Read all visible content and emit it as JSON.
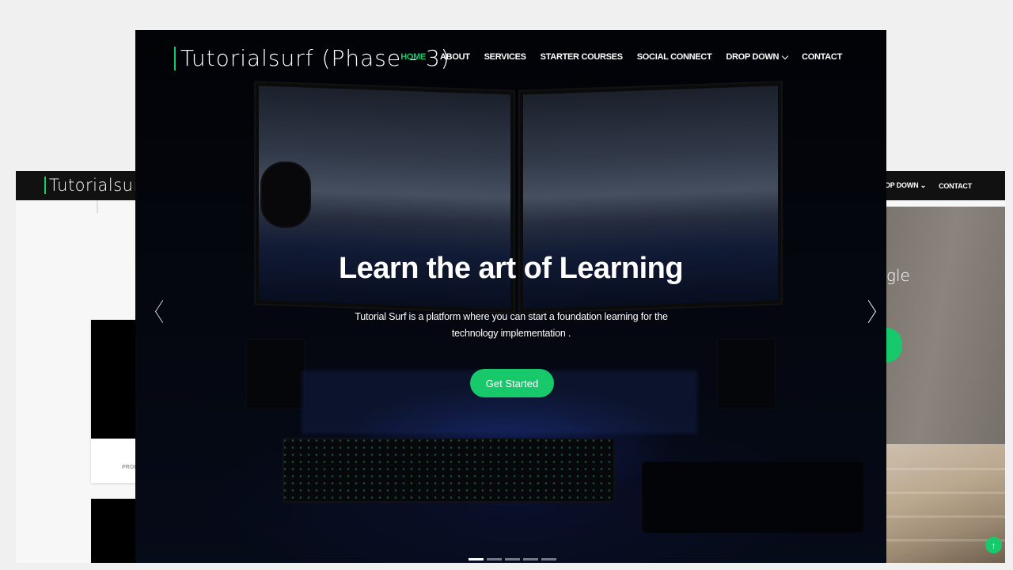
{
  "back_window": {
    "brand": "Tutorialsurf",
    "nav": [
      {
        "label": "DROP DOWN",
        "has_dropdown": true
      },
      {
        "label": "CONTACT"
      }
    ],
    "hero_text_fragment": "gle",
    "card_label_fragment": "PROC",
    "scroll_top_icon": "arrow-up-icon"
  },
  "front_window": {
    "brand": "Tutorialsurf (Phase - 3)",
    "nav": [
      {
        "label": "HOME",
        "active": true
      },
      {
        "label": "ABOUT"
      },
      {
        "label": "SERVICES"
      },
      {
        "label": "STARTER COURSES"
      },
      {
        "label": "SOCIAL CONNECT"
      },
      {
        "label": "DROP DOWN",
        "has_dropdown": true
      },
      {
        "label": "CONTACT"
      }
    ],
    "hero": {
      "title": "Learn the art of Learning",
      "subtitle": "Tutorial Surf is a platform where you can start a foundation learning for the technology implementation .",
      "button": "Get Started"
    },
    "carousel": {
      "slide_count": 5,
      "active_index": 0,
      "prev_icon": "chevron-left-icon",
      "next_icon": "chevron-right-icon"
    }
  },
  "colors": {
    "accent": "#18c96b",
    "nav_dark": "#111111",
    "page_bg": "#f0f0f0"
  }
}
